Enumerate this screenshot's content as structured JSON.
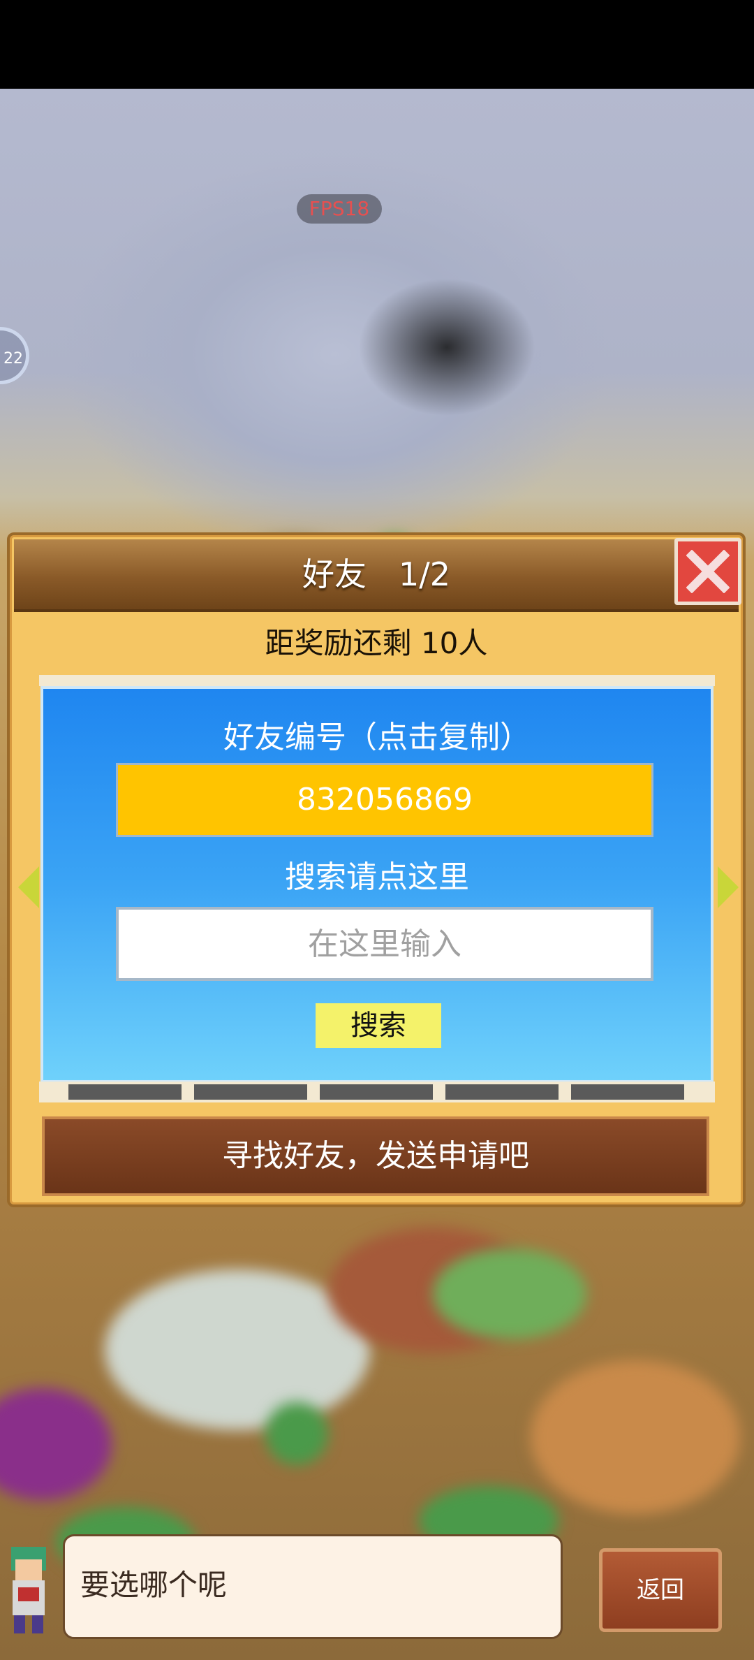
{
  "hud": {
    "fps": "FPS18",
    "side_badge": "22"
  },
  "dialog": {
    "title": "好友　1/2",
    "reward": "距奖励还剩 10人",
    "friend_id_label": "好友编号（点击复制）",
    "friend_id": "832056869",
    "search_label": "搜索请点这里",
    "search_placeholder": "在这里输入",
    "search_button": "搜索",
    "find_friends_button": "寻找好友，发送申请吧"
  },
  "footer": {
    "message": "要选哪个呢",
    "back_button": "返回"
  },
  "colors": {
    "header": "#8a5a28",
    "panel_top": "#1f86f0",
    "id_box": "#ffc400",
    "search_button": "#f4f26a",
    "close_button": "#e2473f"
  },
  "icons": [
    "close-icon",
    "arrow-left-icon",
    "arrow-right-icon",
    "character-avatar"
  ]
}
